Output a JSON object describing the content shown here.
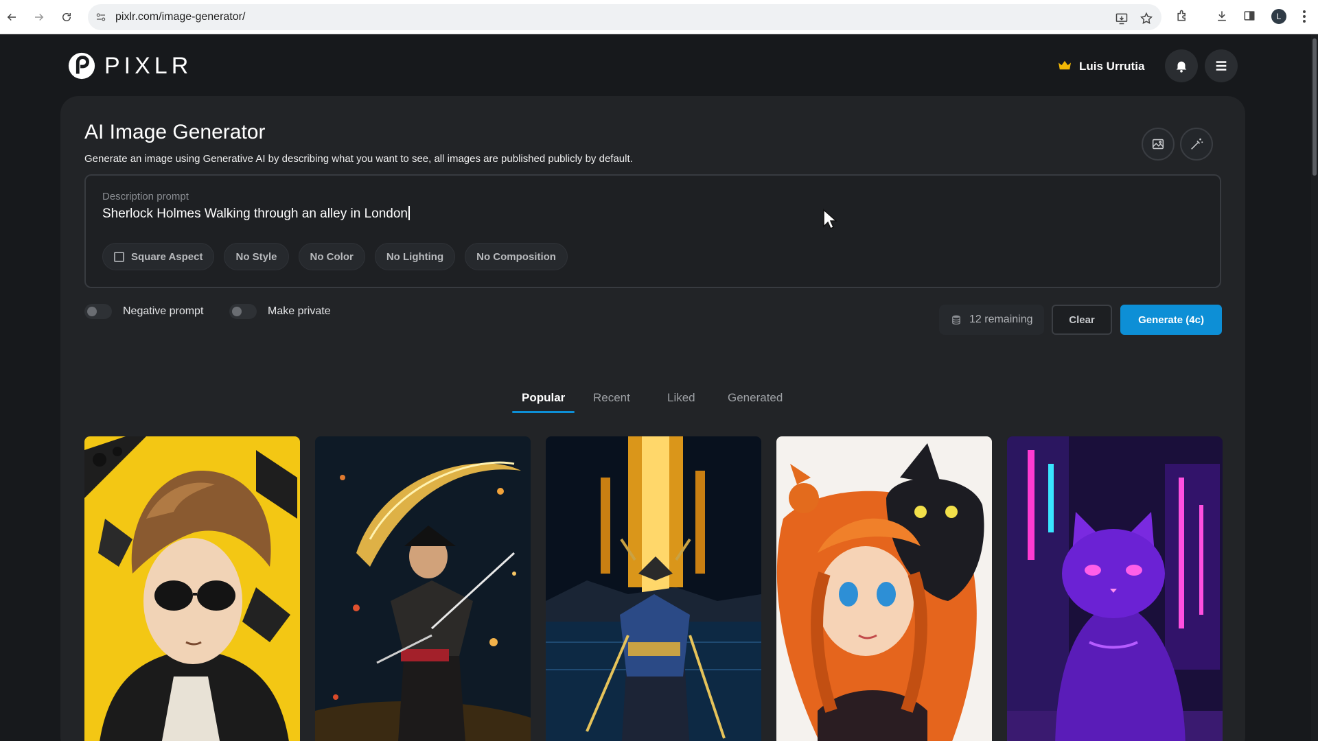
{
  "browser": {
    "url": "pixlr.com/image-generator/",
    "profile_initial": "L"
  },
  "header": {
    "logo_text": "PIXLR",
    "user_name": "Luis Urrutia",
    "crown_color": "#f2b705"
  },
  "main": {
    "title": "AI Image Generator",
    "subtitle": "Generate an image using Generative AI by describing what you want to see, all images are published publicly by default.",
    "prompt": {
      "label": "Description prompt",
      "value": "Sherlock Holmes Walking through an alley in London"
    },
    "options": [
      {
        "label": "Square Aspect",
        "checkbox": true
      },
      {
        "label": "No Style"
      },
      {
        "label": "No Color"
      },
      {
        "label": "No Lighting"
      },
      {
        "label": "No Composition"
      }
    ],
    "toggles": {
      "negative_prompt": {
        "label": "Negative prompt",
        "on": false
      },
      "make_private": {
        "label": "Make private",
        "on": false
      }
    },
    "remaining": "12 remaining",
    "clear_label": "Clear",
    "generate_label": "Generate (4c)",
    "accent_color": "#0d8fd6"
  },
  "tabs": [
    {
      "label": "Popular",
      "active": true
    },
    {
      "label": "Recent",
      "active": false
    },
    {
      "label": "Liked",
      "active": false
    },
    {
      "label": "Generated",
      "active": false
    }
  ],
  "gallery": [
    {
      "subject": "anime boy with sunglasses on yellow background"
    },
    {
      "subject": "samurai with glowing sword at night"
    },
    {
      "subject": "samurai warrior facing golden light over water"
    },
    {
      "subject": "anime girl with orange hair and black cat"
    },
    {
      "subject": "neon purple cat in city street"
    }
  ]
}
